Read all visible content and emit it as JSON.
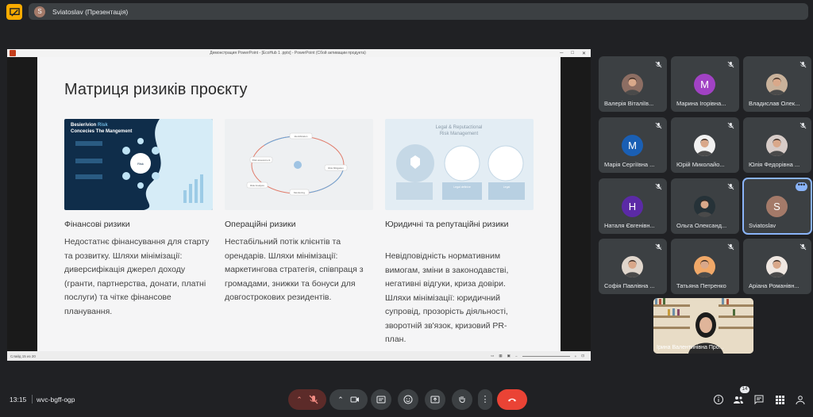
{
  "header": {
    "presenter_initial": "S",
    "presenter_label": "Sviatoslav (Презентація)"
  },
  "ppt": {
    "window_title": "Демонстрация PowerPoint - [EcoHub 1 .pptx] - PowerPoint (Сбой активации продукта)",
    "status_left": "Слайд 15 из 20"
  },
  "slide": {
    "title": "Матриця ризиків проєкту",
    "img1": {
      "line1_a": "Besierivion",
      "line1_b": "Risk",
      "line2": "Concecies  The Mangement",
      "center": "Risk"
    },
    "img2": {
      "labels": [
        "Identification",
        "Risk assessment",
        "Risk Mitigation",
        "Risk Analysis",
        "Monitoring"
      ]
    },
    "img3": {
      "title1": "Legal & Reputactional",
      "title2": "Risk Management",
      "box1": "Legal deflnive",
      "box2": "Legal"
    },
    "columns": [
      {
        "heading": "Фінансові ризики",
        "lines": [
          "Недостатнє фінансування для старту",
          "та розвитку. Шляхи мінімізації:",
          "диверсифікація джерел доходу",
          "(гранти, партнерства, донати, платні",
          "послуги) та чітке фінансове",
          "планування."
        ]
      },
      {
        "heading": "Операційні ризики",
        "lines": [
          "Нестабільний потік клієнтів та",
          "орендарів. Шляхи мінімізації:",
          "маркетингова стратегія, співпраця з",
          "громадами, знижки та бонуси для",
          "довгострокових резидентів."
        ]
      },
      {
        "heading": "Юридичні та репутаційні ризики",
        "lines": [
          "Невідповідність нормативним",
          "вимогам, зміни в законодавстві,",
          "негативні відгуки, криза довіри.",
          "Шляхи мінімізації: юридичний",
          "супровід, прозорість діяльності,",
          "зворотній зв'язок, кризовий PR-",
          "план."
        ]
      }
    ]
  },
  "participants": [
    {
      "name": "Валерія Віталіїв...",
      "initial": "",
      "photo": true,
      "color": "#8d6e63"
    },
    {
      "name": "Марина Ігорівна...",
      "initial": "М",
      "photo": false,
      "color": "#a142c4"
    },
    {
      "name": "Владислав Олек...",
      "initial": "",
      "photo": true,
      "color": "#c9b29b"
    },
    {
      "name": "Марія Сергіївна ...",
      "initial": "М",
      "photo": false,
      "color": "#1a5fb4"
    },
    {
      "name": "Юрій Миколайо...",
      "initial": "",
      "photo": true,
      "color": "#f1f1f1"
    },
    {
      "name": "Юлія Федорівна ...",
      "initial": "",
      "photo": true,
      "color": "#d7ccc8"
    },
    {
      "name": "Наталя Євгенівн...",
      "initial": "Н",
      "photo": false,
      "color": "#5b2aa6"
    },
    {
      "name": "Ольга Олександ...",
      "initial": "",
      "photo": true,
      "color": "#263238"
    },
    {
      "name": "Sviatoslav",
      "initial": "S",
      "photo": false,
      "color": "#a47a69",
      "active": true
    },
    {
      "name": "Софія Павлівна ...",
      "initial": "",
      "photo": true,
      "color": "#e0d6cc"
    },
    {
      "name": "Татьяна Петренко",
      "initial": "",
      "photo": true,
      "color": "#f0a868"
    },
    {
      "name": "Аріана Романівн...",
      "initial": "",
      "photo": true,
      "color": "#efe7e1"
    }
  ],
  "self_view": {
    "name": "Ірина Валентинівна Про..."
  },
  "bottom": {
    "time": "13:15",
    "meeting_code": "wvc-bgff-ogp",
    "people_count": "14"
  }
}
